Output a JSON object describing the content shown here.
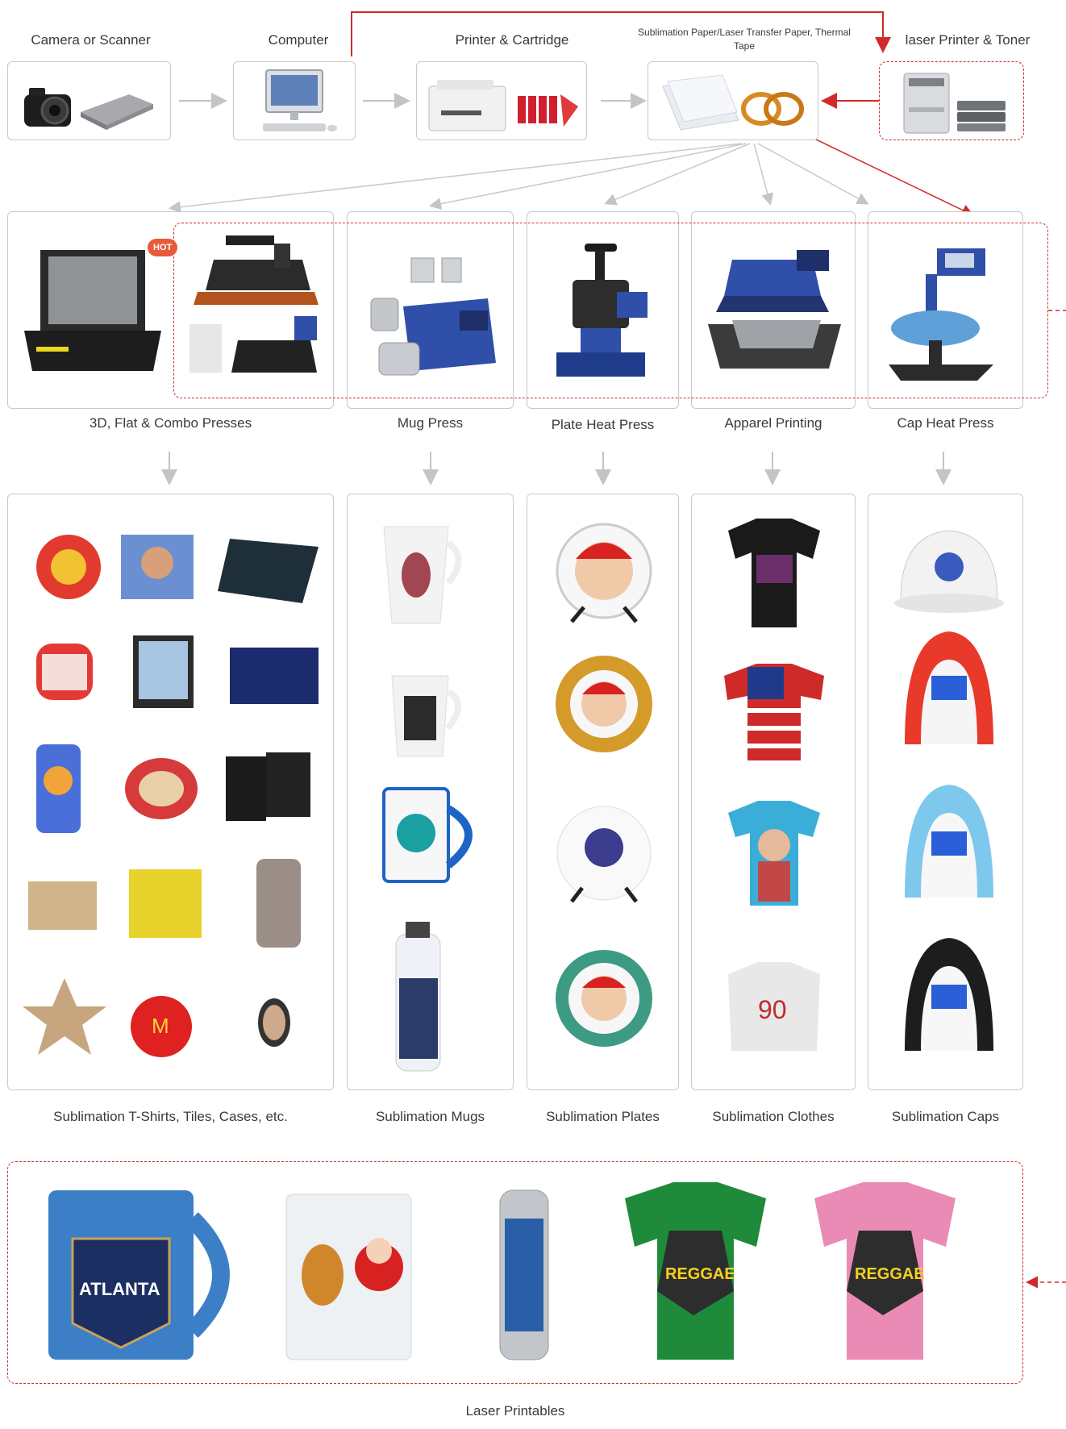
{
  "top": {
    "camera_label": "Camera or Scanner",
    "computer_label": "Computer",
    "printer_label": "Printer & Cartridge",
    "paper_label": "Sublimation Paper/Laser Transfer Paper, Thermal Tape",
    "laser_label": "laser Printer & Toner"
  },
  "presses": {
    "hot_badge": "HOT",
    "labels": [
      "3D, Flat & Combo Presses",
      "Mug Press",
      "Plate Heat Press",
      "Apparel Printing",
      "Cap Heat Press"
    ]
  },
  "products": {
    "labels": [
      "Sublimation T-Shirts, Tiles, Cases, etc.",
      "Sublimation Mugs",
      "Sublimation Plates",
      "Sublimation Clothes",
      "Sublimation Caps"
    ]
  },
  "laser": {
    "label": "Laser Printables",
    "mug_text": "ATLANTA",
    "tshirt_text": "REGGAE"
  },
  "colors": {
    "accent_red": "#d22a2a",
    "connector_grey": "#bdbdbd",
    "blue_machine": "#2f4fa8"
  }
}
